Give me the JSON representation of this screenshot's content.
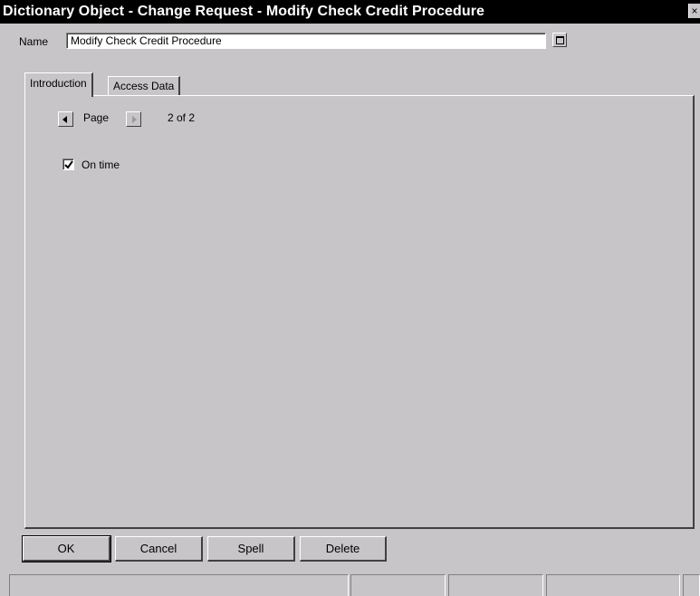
{
  "window": {
    "title": "Dictionary Object - Change Request - Modify Check Credit Procedure",
    "close_glyph": "×"
  },
  "name_field": {
    "label": "Name",
    "value": "Modify Check Credit Procedure"
  },
  "tabs": [
    {
      "label": "Introduction",
      "active": true
    },
    {
      "label": "Access Data",
      "active": false
    }
  ],
  "pager": {
    "label": "Page",
    "count": "2 of 2"
  },
  "checkbox": {
    "label": "On time",
    "checked": true
  },
  "buttons": {
    "ok": "OK",
    "cancel": "Cancel",
    "spell": "Spell",
    "delete": "Delete"
  },
  "icons": {
    "prev": "left-arrow-icon",
    "next": "right-arrow-icon",
    "expand": "window-restore-icon",
    "check": "checkmark-icon"
  },
  "colors": {
    "window_bg": "#c7c5c8",
    "titlebar_bg": "#000000",
    "titlebar_text": "#ffffff"
  }
}
